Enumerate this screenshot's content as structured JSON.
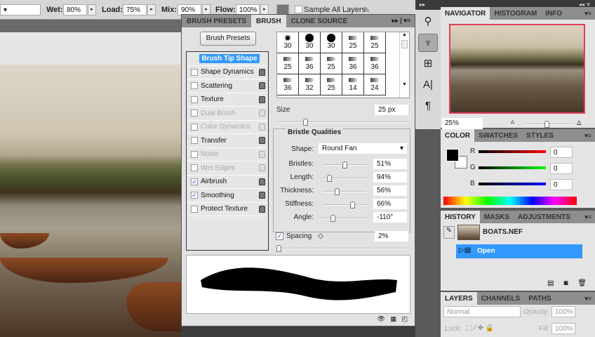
{
  "options_bar": {
    "wet_label": "Wet:",
    "wet": "80%",
    "load_label": "Load:",
    "load": "75%",
    "mix_label": "Mix:",
    "mix": "90%",
    "flow_label": "Flow:",
    "flow": "100%",
    "sample_all_layers": "Sample All Layers"
  },
  "brush_panel": {
    "tabs": [
      "BRUSH PRESETS",
      "BRUSH",
      "CLONE SOURCE"
    ],
    "active_tab": "BRUSH",
    "presets_button": "Brush Presets",
    "options": [
      {
        "label": "Brush Tip Shape",
        "selected": true
      },
      {
        "label": "Shape Dynamics",
        "checked": false,
        "enabled": true
      },
      {
        "label": "Scattering",
        "checked": false,
        "enabled": true
      },
      {
        "label": "Texture",
        "checked": false,
        "enabled": true
      },
      {
        "label": "Dual Brush",
        "checked": false,
        "enabled": false
      },
      {
        "label": "Color Dynamics",
        "checked": false,
        "enabled": false
      },
      {
        "label": "Transfer",
        "checked": false,
        "enabled": true
      },
      {
        "label": "Noise",
        "checked": false,
        "enabled": false
      },
      {
        "label": "Wet Edges",
        "checked": false,
        "enabled": false
      },
      {
        "label": "Airbrush",
        "checked": true,
        "enabled": true
      },
      {
        "label": "Smoothing",
        "checked": true,
        "enabled": true
      },
      {
        "label": "Protect Texture",
        "checked": false,
        "enabled": true
      }
    ],
    "tip_sizes": [
      "30",
      "30",
      "30",
      "25",
      "25",
      "25",
      "36",
      "25",
      "36",
      "36",
      "36",
      "32",
      "25",
      "14",
      "24"
    ],
    "size_label": "Size",
    "size": "25 px",
    "bristle_title": "Bristle Qualities",
    "shape_label": "Shape:",
    "shape": "Round Fan",
    "bristle_params": [
      {
        "label": "Bristles:",
        "value": "51%",
        "pos": 0.5
      },
      {
        "label": "Length:",
        "value": "94%",
        "pos": 0.1
      },
      {
        "label": "Thickness:",
        "value": "56%",
        "pos": 0.3
      },
      {
        "label": "Stiffness:",
        "value": "66%",
        "pos": 0.7
      },
      {
        "label": "Angle:",
        "value": "-110°",
        "pos": 0.2
      }
    ],
    "spacing_label": "Spacing",
    "spacing": "2%"
  },
  "navigator": {
    "tabs": [
      "NAVIGATOR",
      "HISTOGRAM",
      "INFO"
    ],
    "zoom": "25%"
  },
  "color": {
    "tabs": [
      "COLOR",
      "SWATCHES",
      "STYLES"
    ],
    "r": "0",
    "g": "0",
    "b": "0",
    "r_label": "R",
    "g_label": "G",
    "b_label": "B"
  },
  "history": {
    "tabs": [
      "HISTORY",
      "MASKS",
      "ADJUSTMENTS"
    ],
    "snapshot": "BOATS.NEF",
    "states": [
      "Open"
    ]
  },
  "layers": {
    "tabs": [
      "LAYERS",
      "CHANNELS",
      "PATHS"
    ],
    "blend_mode": "Normal",
    "opacity_label": "Opacity:",
    "opacity": "100%",
    "lock_label": "Lock:",
    "fill_label": "Fill:",
    "fill": "100%"
  }
}
